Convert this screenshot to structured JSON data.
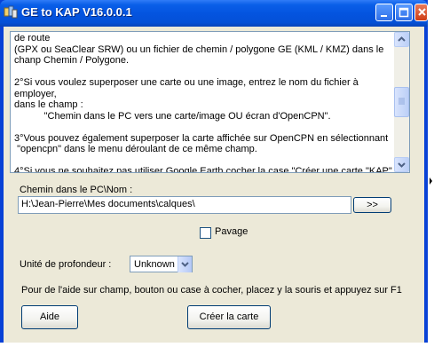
{
  "window": {
    "title": "GE to KAP V16.0.0.1"
  },
  "help_text": {
    "content": "de route\n(GPX ou SeaClear SRW) ou un fichier de chemin / polygone GE (KML / KMZ) dans le\nchanp Chemin / Polygone.\n\n2°Si vous voulez superposer une carte ou une image, entrez le nom du fichier à employer,\ndans le champ :\n           \"Chemin dans le PC vers une carte/image OU écran d'OpenCPN\".\n\n3°Vous pouvez également superposer la carte affichée sur OpenCPN en sélectionnant\n \"opencpn\" dans le menu déroulant de ce même champ.\n\n4°Si vous ne souhaitez pas utiliser Google Earth cocher la case \"Créer une carte \"KAP\""
  },
  "path": {
    "label": "Chemin dans le PC\\Nom :",
    "value": "H:\\Jean-Pierre\\Mes documents\\calques\\",
    "browse_label": ">>"
  },
  "pavage": {
    "label": "Pavage",
    "checked": false
  },
  "depth": {
    "label": "Unité de profondeur :",
    "selected": "Unknown"
  },
  "hint": {
    "text": "Pour de l'aide sur champ, bouton ou case à cocher, placez y la souris et appuyez sur F1"
  },
  "buttons": {
    "help_label": "Aide",
    "create_label": "Créer la carte"
  },
  "colors": {
    "titlebar": "#0454e0",
    "client_bg": "#ece9d8",
    "button_border": "#003c74"
  }
}
